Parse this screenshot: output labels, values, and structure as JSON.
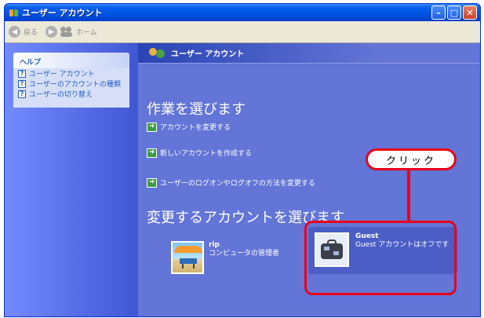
{
  "window": {
    "title": "ユーザー アカウント",
    "buttons": [
      "minimize-icon",
      "maximize-icon",
      "close-icon"
    ]
  },
  "toolbar": {
    "back_label": "戻る",
    "home_label": "ホーム"
  },
  "sidebar": {
    "help_title": "ヘルプ",
    "items": [
      {
        "label": "ユーザー アカウント"
      },
      {
        "label": "ユーザーのアカウントの種類"
      },
      {
        "label": "ユーザーの切り替え"
      }
    ]
  },
  "main": {
    "header_title": "ユーザー アカウント",
    "task_heading": "作業を選びます",
    "tasks": [
      {
        "label": "アカウントを変更する"
      },
      {
        "label": "新しいアカウントを作成する"
      },
      {
        "label": "ユーザーのログオンやログオフの方法を変更する"
      }
    ],
    "account_heading": "変更するアカウントを選びます",
    "accounts": [
      {
        "name": "rip",
        "description": "コンピュータの管理者"
      },
      {
        "name": "Guest",
        "description": "Guest アカウントはオフです"
      }
    ]
  },
  "annotation": {
    "callout_text": "クリック",
    "color": "#e8001c"
  },
  "colors": {
    "titlebar": "#0054e3",
    "content_bg": "#6375d6",
    "help_text": "#215dc6"
  }
}
